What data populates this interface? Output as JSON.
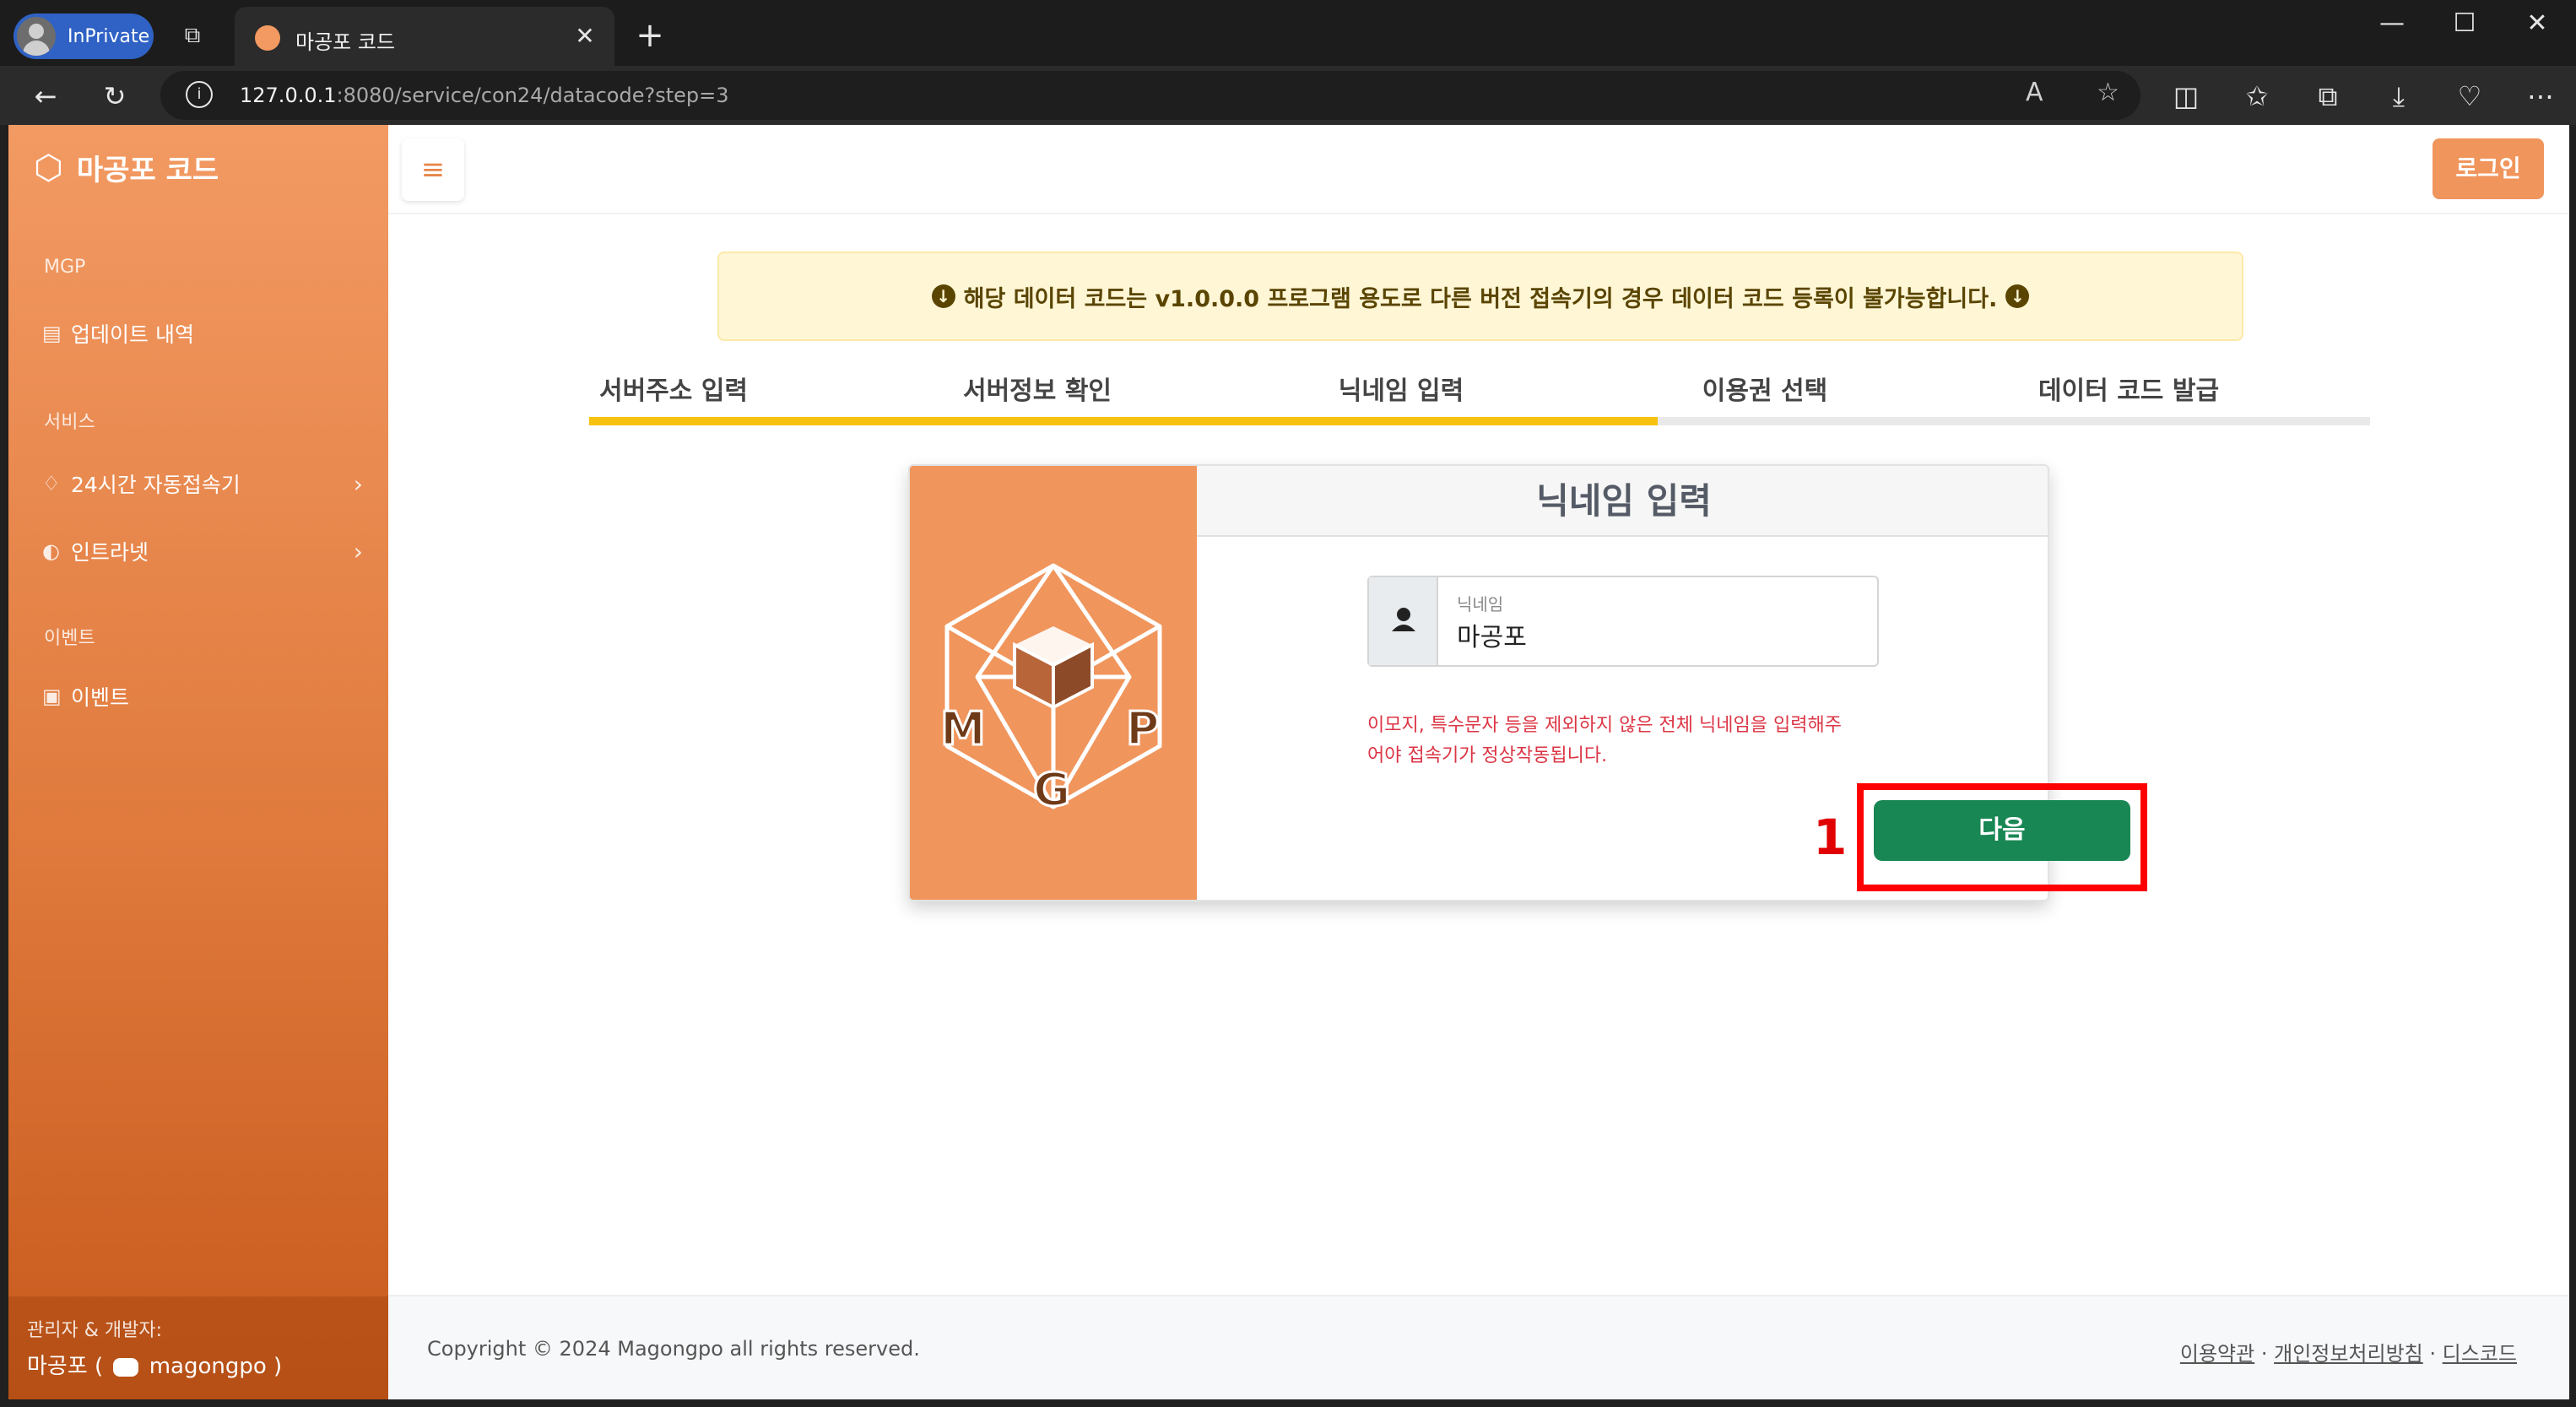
{
  "browser": {
    "profile_label": "InPrivate",
    "tab_title": "마공포 코드",
    "url_host": "127.0.0.1",
    "url_rest": ":8080/service/con24/datacode?step=3"
  },
  "sidebar": {
    "brand": "마공포 코드",
    "sections": [
      {
        "heading": "MGP",
        "items": [
          {
            "label": "업데이트 내역",
            "icon": "clipboard-icon"
          }
        ]
      },
      {
        "heading": "서비스",
        "items": [
          {
            "label": "24시간 자동접속기",
            "icon": "lightbulb-icon"
          },
          {
            "label": "인트라넷",
            "icon": "contrast-icon"
          }
        ]
      },
      {
        "heading": "이벤트",
        "items": [
          {
            "label": "이벤트",
            "icon": "calendar-check-icon"
          }
        ]
      }
    ],
    "footer_title": "관리자 & 개발자:",
    "footer_name": "마공포 (",
    "footer_discord": "magongpo",
    "footer_close": ")"
  },
  "header": {
    "login_label": "로그인"
  },
  "notice": {
    "text": "해당 데이터 코드는 v1.0.0.0 프로그램 용도로 다른 버전 접속기의 경우 데이터 코드 등록이 불가능합니다."
  },
  "steps": {
    "items": [
      "서버주소 입력",
      "서버정보 확인",
      "닉네임 입력",
      "이용권 선택",
      "데이터 코드 발급"
    ],
    "current": 3,
    "progress": 0.6
  },
  "card": {
    "title": "닉네임 입력",
    "field_label": "닉네임",
    "field_value": "마공포",
    "hint_line1": "이모지, 특수문자 등을 제외하지 않은 전체 닉네임을 입력해주",
    "hint_line2": "어야 접속기가 정상작동됩니다.",
    "next_label": "다음",
    "logo_letters": "MGP"
  },
  "annotation": {
    "number": "1"
  },
  "footer": {
    "copyright": "Copyright © 2024 Magongpo all rights reserved.",
    "links": [
      "이용약관",
      "개인정보처리방침",
      "디스코드"
    ],
    "separator": "·"
  },
  "colors": {
    "accent": "#f0955c",
    "success": "#198754",
    "progress": "#f7c20f",
    "danger": "#dc3545"
  }
}
